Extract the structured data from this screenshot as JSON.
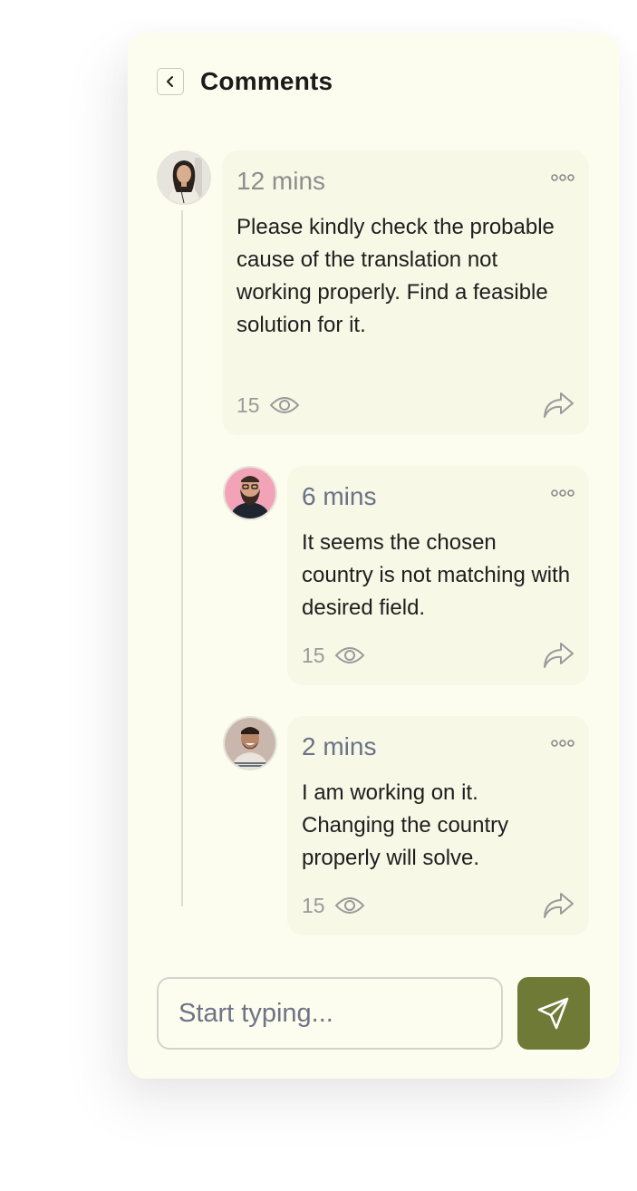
{
  "header": {
    "title": "Comments",
    "back_icon": "chevron-left-icon"
  },
  "comments": [
    {
      "time": "12 mins",
      "text": "Please kindly check the probable cause of the translation not working properly. Find a feasible solution for it.",
      "views": "15",
      "avatar": "woman-avatar"
    },
    {
      "time": "6 mins",
      "text": "It seems the chosen country is not matching with desired field.",
      "views": "15",
      "avatar": "bearded-man-avatar"
    },
    {
      "time": "2 mins",
      "text": "I am working on it. Changing the country properly will solve.",
      "views": "15",
      "avatar": "smiling-man-avatar"
    }
  ],
  "composer": {
    "placeholder": "Start typing...",
    "value": "",
    "send_icon": "paper-plane-icon"
  },
  "colors": {
    "panel_bg": "#fdfdef",
    "card_bg": "#f7f8e6",
    "send_button": "#6e7a35",
    "reply_time": "#6b7187"
  }
}
